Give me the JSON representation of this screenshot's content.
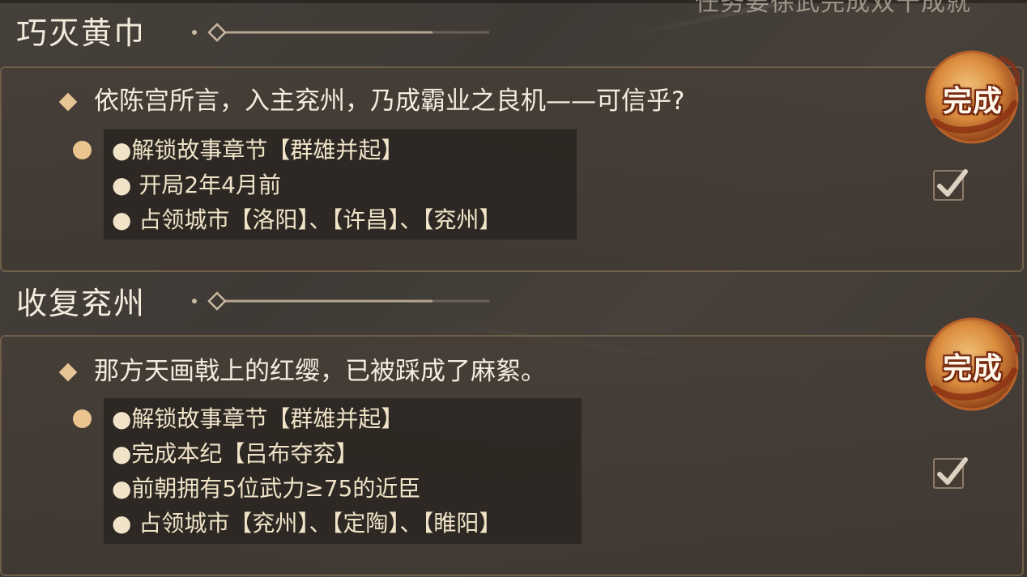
{
  "header": {
    "clipped_text": "任务要徐武完成双十成就"
  },
  "quests": [
    {
      "section_title": "巧灭黄巾",
      "description": "依陈宫所言，入主兖州，乃成霸业之良机——可信乎?",
      "requirements": [
        "●解锁故事章节【群雄并起】",
        "● 开局2年4月前",
        "● 占领城市【洛阳】、【许昌】、【兖州】"
      ],
      "stamp_label": "完成",
      "checked": true
    },
    {
      "section_title": "收复兖州",
      "description": "那方天画戟上的红缨，已被踩成了麻絮。",
      "requirements": [
        "●解锁故事章节【群雄并起】",
        "●完成本纪【吕布夺兖】",
        "●前朝拥有5位武力≥75的近臣",
        "● 占领城市【兖州】、【定陶】、【睢阳】"
      ],
      "stamp_label": "完成",
      "checked": true
    }
  ],
  "colors": {
    "background": "#433d37",
    "panel_border": "#6e5d48",
    "accent_gold": "#e8c594",
    "stamp_orange": "#d8883e"
  },
  "icons": {
    "diamond": "diamond-bullet-icon",
    "orb": "orb-bullet-icon",
    "check": "checkmark-icon",
    "stamp": "complete-stamp-icon"
  }
}
